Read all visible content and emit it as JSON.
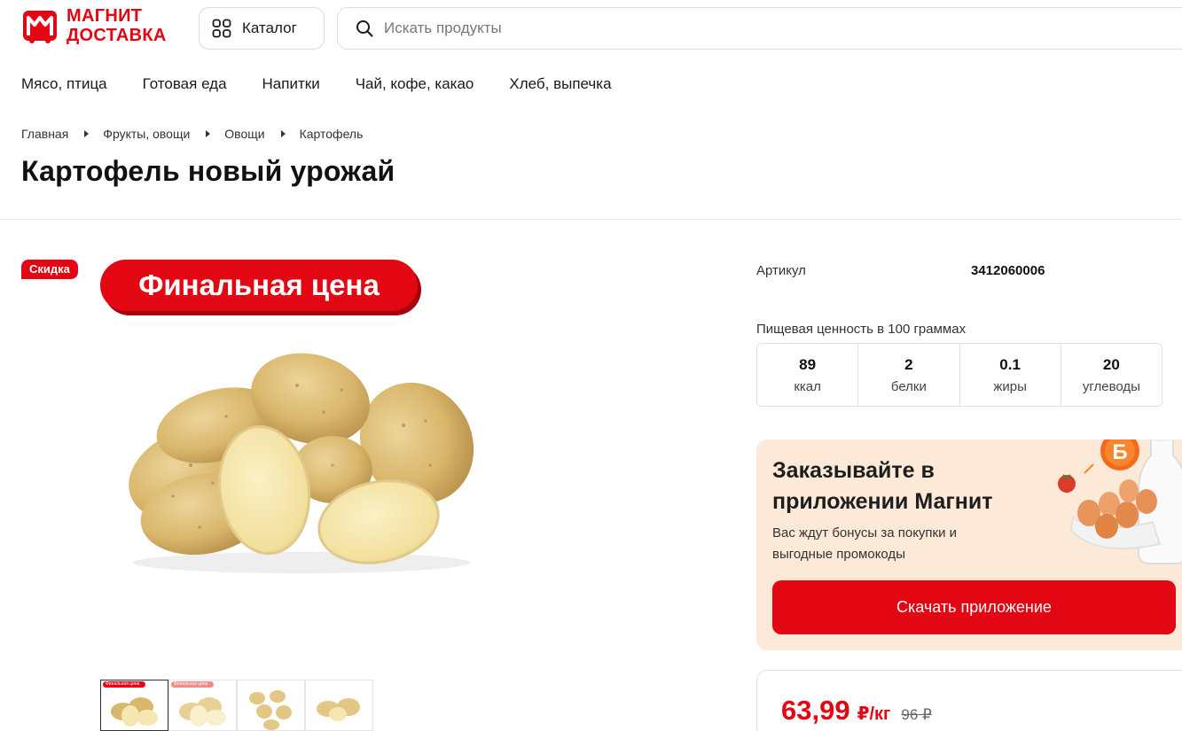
{
  "header": {
    "logo_line1": "МАГНИТ",
    "logo_line2": "ДОСТАВКА",
    "catalog_label": "Каталог",
    "search_placeholder": "Искать продукты",
    "brand_color": "#e30613"
  },
  "category_nav": [
    "Мясо, птица",
    "Готовая еда",
    "Напитки",
    "Чай, кофе, какао",
    "Хлеб, выпечка"
  ],
  "breadcrumb": [
    "Главная",
    "Фрукты, овощи",
    "Овощи",
    "Картофель"
  ],
  "product": {
    "title": "Картофель новый урожай",
    "badge_sale": "Скидка",
    "badge_final": "Финальная цена",
    "thumbnails": [
      {
        "badge": "Финальная цена",
        "active": true
      },
      {
        "badge": "Финальная цена",
        "active": false
      },
      {
        "badge": "",
        "active": false
      },
      {
        "badge": "",
        "active": false
      }
    ]
  },
  "details": {
    "article_label": "Артикул",
    "article_value": "3412060006",
    "nutrition_title": "Пищевая ценность в 100 граммах",
    "nutrition": [
      {
        "value": "89",
        "unit": "ккал"
      },
      {
        "value": "2",
        "unit": "белки"
      },
      {
        "value": "0.1",
        "unit": "жиры"
      },
      {
        "value": "20",
        "unit": "углеводы"
      }
    ]
  },
  "promo": {
    "title": "Заказывайте в приложении Магнит",
    "subtitle": "Вас ждут бонусы за покупки и выгодные промокоды",
    "button": "Скачать приложение",
    "bonus_letter": "Б"
  },
  "price": {
    "current": "63,99",
    "unit": "₽/кг",
    "old": "96 ₽"
  }
}
